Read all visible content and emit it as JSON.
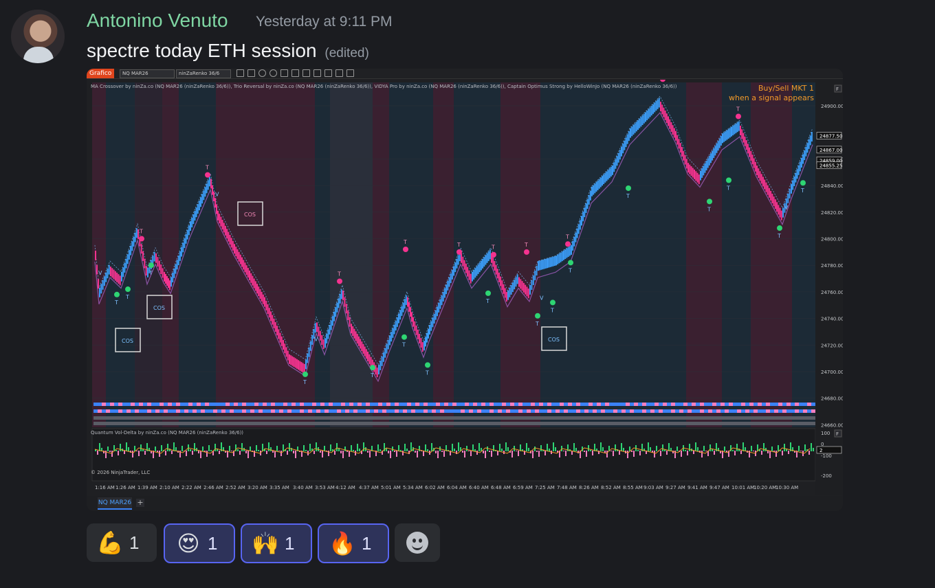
{
  "message": {
    "author": "Antonino Venuto",
    "timestamp": "Yesterday at 9:11 PM",
    "text": "spectre today ETH session",
    "edited": "(edited)"
  },
  "chart_window": {
    "tag": "Grafico",
    "instrument_select": "NQ MAR26",
    "chart_type_select": "ninZaRenko 36/6",
    "indicators_label": "MA Crossover by ninZa.co (NQ MAR26 (ninZaRenko 36/6)), Trio Reversal by ninZa.co (NQ MAR26 (ninZaRenko 36/6)), VIDYA Pro by ninZa.co (NQ MAR26 (ninZaRenko 36/6)), Captain Optimus Strong by HelloWinJo (NQ MAR26 (ninZaRenko 36/6))",
    "buysell_line1": "Buy/Sell MKT 1",
    "buysell_line2": "when a signal appears",
    "lower_panel_label": "Quantum Vol-Delta by ninZa.co (NQ MAR26 (ninZaRenko 36/6))",
    "copyright": "© 2026 NinjaTrader, LLC",
    "panel_buttons": [
      "F",
      "F"
    ],
    "price_labels": [
      "24900.00",
      "24860.00",
      "24840.00",
      "24820.00",
      "24800.00",
      "24780.00",
      "24760.00",
      "24740.00",
      "24720.00",
      "24700.00",
      "24680.00",
      "24660.00"
    ],
    "flagged_prices": [
      "24877.50",
      "24867.00",
      "24859.00",
      "24855.25"
    ],
    "lower_axis_labels": [
      "100",
      "0",
      "-100",
      "-200"
    ],
    "lower_flag": "2",
    "time_labels": [
      "1:16 AM",
      "1:26 AM",
      "1:39 AM",
      "2:10 AM",
      "2:22 AM",
      "2:46 AM",
      "2:52 AM",
      "3:20 AM",
      "3:35 AM",
      "3:40 AM",
      "3:53 AM",
      "4:12 AM",
      "4:37 AM",
      "5:01 AM",
      "5:34 AM",
      "6:02 AM",
      "6:04 AM",
      "6:40 AM",
      "6:48 AM",
      "6:59 AM",
      "7:25 AM",
      "7:48 AM",
      "8:26 AM",
      "8:52 AM",
      "8:55 AM",
      "9:03 AM",
      "9:27 AM",
      "9:41 AM",
      "9:47 AM",
      "10:01 AM",
      "10:20 AM",
      "10:30 AM"
    ],
    "cos_label": "COS",
    "signal_t": "T",
    "signal_v": "V",
    "tab": "NQ MAR26",
    "tab_add": "+"
  },
  "reactions": [
    {
      "emoji": "💪",
      "count": "1",
      "me": false
    },
    {
      "emoji": "😍",
      "count": "1",
      "me": true
    },
    {
      "emoji": "🙌",
      "count": "1",
      "me": true
    },
    {
      "emoji": "🔥",
      "count": "1",
      "me": true
    }
  ],
  "colors": {
    "bull": "#3b9cf6",
    "bear": "#f4338f",
    "signal_green": "#2ed573",
    "buysell": "#f39a29",
    "author": "#7fd6a3",
    "accent": "#5865f2"
  }
}
